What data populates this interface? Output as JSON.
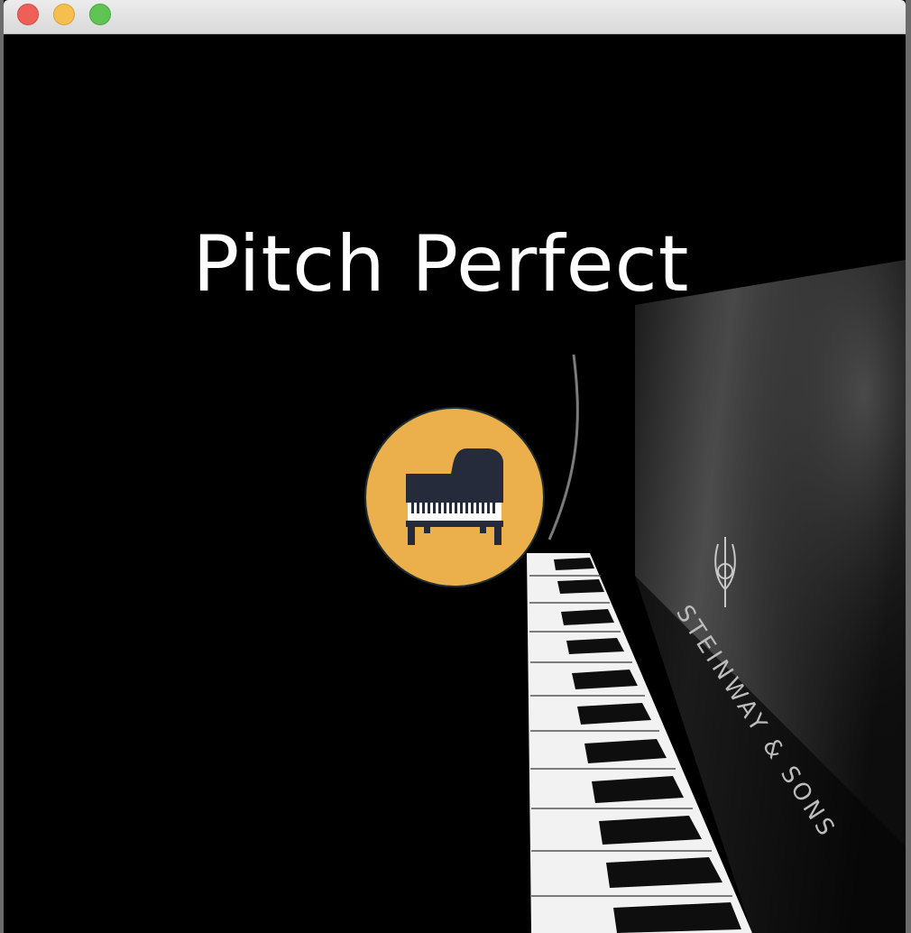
{
  "window": {
    "controls": [
      "close",
      "minimize",
      "zoom"
    ]
  },
  "main": {
    "title": "Pitch Perfect",
    "record_button": {
      "icon": "grand-piano-icon",
      "color": "#ebb04b"
    },
    "background": {
      "brand_text": "STEINWAY & SONS"
    }
  },
  "colors": {
    "background": "#000000",
    "title_text": "#ffffff",
    "accent": "#ebb04b",
    "icon": "#252b3a"
  }
}
